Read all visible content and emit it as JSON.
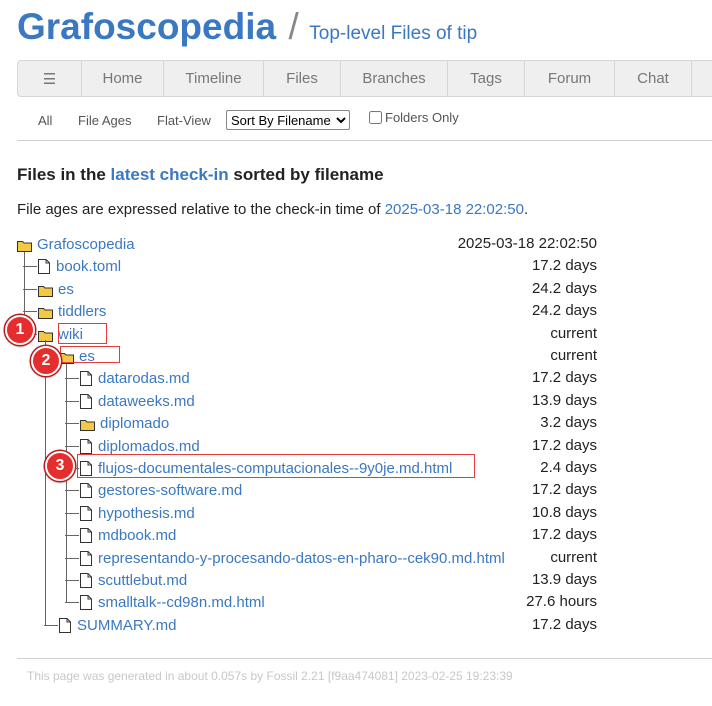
{
  "header": {
    "project": "Grafoscopedia",
    "separator": "/",
    "subtitle": "Top-level Files of tip"
  },
  "mainmenu": {
    "hamburger": "☰",
    "items": [
      "Home",
      "Timeline",
      "Files",
      "Branches",
      "Tags",
      "Forum",
      "Chat"
    ]
  },
  "submenu": {
    "all": "All",
    "file_ages": "File Ages",
    "flat_view": "Flat-View",
    "sort_selected": "Sort By Filename",
    "folders_only": "Folders Only"
  },
  "heading": {
    "prefix": "Files in the",
    "link": "latest check-in",
    "suffix": "sorted by filename"
  },
  "ages_note": {
    "prefix": "File ages are expressed relative to the check-in time of",
    "timestamp": "2025-03-18 22:02:50",
    "suffix": "."
  },
  "tree": [
    {
      "name": "Grafoscopedia",
      "type": "folder",
      "age": "2025-03-18 22:02:50"
    },
    {
      "name": "book.toml",
      "type": "file",
      "age": "17.2 days"
    },
    {
      "name": "es",
      "type": "folder",
      "age": "24.2 days"
    },
    {
      "name": "tiddlers",
      "type": "folder",
      "age": "24.2 days"
    },
    {
      "name": "wiki",
      "type": "folder",
      "age": "current"
    },
    {
      "name": "es",
      "type": "folder",
      "age": "current"
    },
    {
      "name": "datarodas.md",
      "type": "file",
      "age": "17.2 days"
    },
    {
      "name": "dataweeks.md",
      "type": "file",
      "age": "13.9 days"
    },
    {
      "name": "diplomado",
      "type": "folder",
      "age": "3.2 days"
    },
    {
      "name": "diplomados.md",
      "type": "file",
      "age": "17.2 days"
    },
    {
      "name": "flujos-documentales-computacionales--9y0je.md.html",
      "type": "file",
      "age": "2.4 days"
    },
    {
      "name": "gestores-software.md",
      "type": "file",
      "age": "17.2 days"
    },
    {
      "name": "hypothesis.md",
      "type": "file",
      "age": "10.8 days"
    },
    {
      "name": "mdbook.md",
      "type": "file",
      "age": "17.2 days"
    },
    {
      "name": "representando-y-procesando-datos-en-pharo--cek90.md.html",
      "type": "file",
      "age": "current"
    },
    {
      "name": "scuttlebut.md",
      "type": "file",
      "age": "13.9 days"
    },
    {
      "name": "smalltalk--cd98n.md.html",
      "type": "file",
      "age": "27.6 hours"
    },
    {
      "name": "SUMMARY.md",
      "type": "file",
      "age": "17.2 days"
    }
  ],
  "annotations": [
    "1",
    "2",
    "3"
  ],
  "footer": "This page was generated in about 0.057s by Fossil 2.21 [f9aa474081] 2023-02-25 19:23:39",
  "colors": {
    "link": "#3a78c2",
    "folder_fill": "#f5c842",
    "annotation": "#e52d2d"
  }
}
